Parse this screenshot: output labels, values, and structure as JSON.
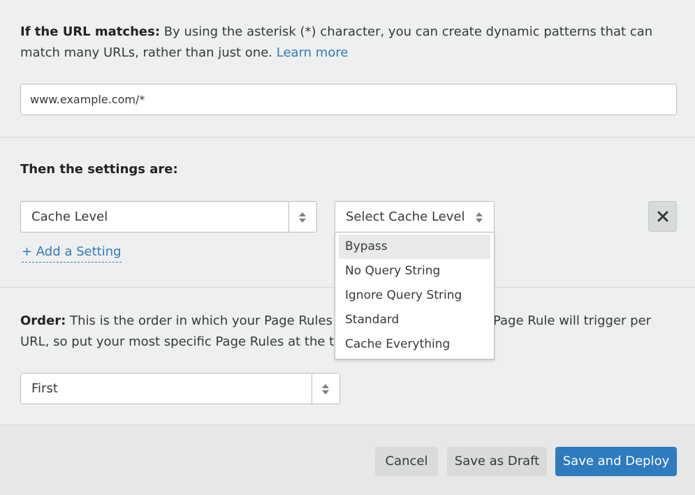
{
  "url_section": {
    "label": "If the URL matches:",
    "description": " By using the asterisk (*) character, you can create dynamic patterns that can match many URLs, rather than just one. ",
    "learn_more": "Learn more",
    "url_value": "www.example.com/*"
  },
  "settings_section": {
    "heading": "Then the settings are:",
    "setting_select_value": "Cache Level",
    "value_select_value": "Select Cache Level",
    "add_setting": "+ Add a Setting",
    "dropdown_options": [
      "Bypass",
      "No Query String",
      "Ignore Query String",
      "Standard",
      "Cache Everything"
    ],
    "highlighted_option": "Bypass"
  },
  "order_section": {
    "label": "Order:",
    "description_left": " This is the order in which your Page Rules w",
    "description_right": "Page Rule will trigger per",
    "description_line2": "URL, so put your most specific Page Rules at the top",
    "order_value": "First"
  },
  "footer": {
    "cancel": "Cancel",
    "save_draft": "Save as Draft",
    "save_deploy": "Save and Deploy"
  },
  "colors": {
    "accent": "#2f7bbf",
    "background": "#eef0ef",
    "footer_bg": "#e6e7e7"
  }
}
